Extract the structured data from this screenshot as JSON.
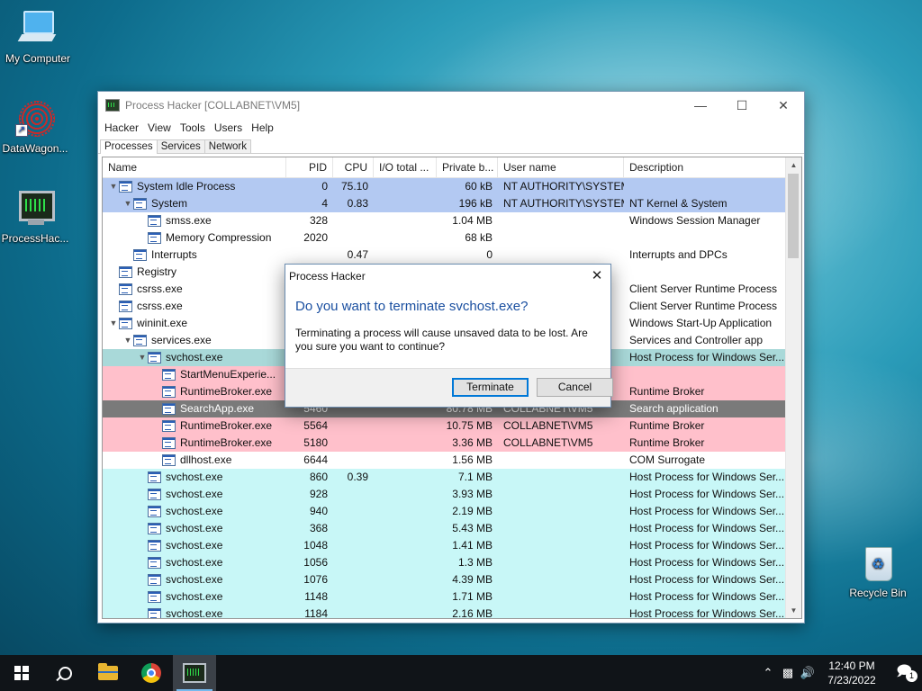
{
  "desktop": {
    "icons": [
      {
        "label": "My Computer"
      },
      {
        "label": "DataWagon..."
      },
      {
        "label": "ProcessHac..."
      },
      {
        "label": "Recycle Bin"
      }
    ]
  },
  "window": {
    "title": "Process Hacker [COLLABNET\\VM5]",
    "menu": [
      "Hacker",
      "View",
      "Tools",
      "Users",
      "Help"
    ],
    "tabs": [
      "Processes",
      "Services",
      "Network"
    ],
    "columns": [
      "Name",
      "PID",
      "CPU",
      "I/O total ...",
      "Private b...",
      "User name",
      "Description"
    ],
    "rows": [
      {
        "name": "System Idle Process",
        "level": 0,
        "expander": "▼",
        "pid": "0",
        "cpu": "75.10",
        "io": "",
        "priv": "60 kB",
        "user": "NT AUTHORITY\\SYSTEM",
        "desc": "",
        "bg": "#b3c9f2"
      },
      {
        "name": "System",
        "level": 1,
        "expander": "▼",
        "pid": "4",
        "cpu": "0.83",
        "io": "",
        "priv": "196 kB",
        "user": "NT AUTHORITY\\SYSTEM",
        "desc": "NT Kernel & System",
        "bg": "#b3c9f2"
      },
      {
        "name": "smss.exe",
        "level": 2,
        "expander": "",
        "pid": "328",
        "cpu": "",
        "io": "",
        "priv": "1.04 MB",
        "user": "",
        "desc": "Windows Session Manager",
        "bg": "#ffffff"
      },
      {
        "name": "Memory Compression",
        "level": 2,
        "expander": "",
        "pid": "2020",
        "cpu": "",
        "io": "",
        "priv": "68 kB",
        "user": "",
        "desc": "",
        "bg": "#ffffff"
      },
      {
        "name": "Interrupts",
        "level": 1,
        "expander": "",
        "pid": "",
        "cpu": "0.47",
        "io": "",
        "priv": "0",
        "user": "",
        "desc": "Interrupts and DPCs",
        "bg": "#ffffff"
      },
      {
        "name": "Registry",
        "level": 0,
        "expander": "",
        "pid": "",
        "cpu": "",
        "io": "",
        "priv": "",
        "user": "",
        "desc": "",
        "bg": "#ffffff"
      },
      {
        "name": "csrss.exe",
        "level": 0,
        "expander": "",
        "pid": "",
        "cpu": "",
        "io": "",
        "priv": "",
        "user": "",
        "desc": "Client Server Runtime Process",
        "bg": "#ffffff"
      },
      {
        "name": "csrss.exe",
        "level": 0,
        "expander": "",
        "pid": "",
        "cpu": "",
        "io": "",
        "priv": "",
        "user": "",
        "desc": "Client Server Runtime Process",
        "bg": "#ffffff"
      },
      {
        "name": "wininit.exe",
        "level": 0,
        "expander": "▼",
        "pid": "",
        "cpu": "",
        "io": "",
        "priv": "",
        "user": "",
        "desc": "Windows Start-Up Application",
        "bg": "#ffffff"
      },
      {
        "name": "services.exe",
        "level": 1,
        "expander": "▼",
        "pid": "",
        "cpu": "",
        "io": "",
        "priv": "",
        "user": "",
        "desc": "Services and Controller app",
        "bg": "#ffffff"
      },
      {
        "name": "svchost.exe",
        "level": 2,
        "expander": "▼",
        "pid": "",
        "cpu": "",
        "io": "",
        "priv": "",
        "user": "",
        "desc": "Host Process for Windows Ser...",
        "bg": "#a9d9d9"
      },
      {
        "name": "StartMenuExperie...",
        "level": 3,
        "expander": "",
        "pid": "",
        "cpu": "",
        "io": "",
        "priv": "",
        "user": "",
        "desc": "",
        "bg": "#ffc0cb"
      },
      {
        "name": "RuntimeBroker.exe",
        "level": 3,
        "expander": "",
        "pid": "",
        "cpu": "",
        "io": "",
        "priv": "",
        "user": "",
        "desc": "Runtime Broker",
        "bg": "#ffc0cb"
      },
      {
        "name": "SearchApp.exe",
        "level": 3,
        "expander": "",
        "pid": "5460",
        "cpu": "",
        "io": "",
        "priv": "80.78 MB",
        "user": "COLLABNET\\VM5",
        "desc": "Search application",
        "bg": "#7a7a7a"
      },
      {
        "name": "RuntimeBroker.exe",
        "level": 3,
        "expander": "",
        "pid": "5564",
        "cpu": "",
        "io": "",
        "priv": "10.75 MB",
        "user": "COLLABNET\\VM5",
        "desc": "Runtime Broker",
        "bg": "#ffc0cb"
      },
      {
        "name": "RuntimeBroker.exe",
        "level": 3,
        "expander": "",
        "pid": "5180",
        "cpu": "",
        "io": "",
        "priv": "3.36 MB",
        "user": "COLLABNET\\VM5",
        "desc": "Runtime Broker",
        "bg": "#ffc0cb"
      },
      {
        "name": "dllhost.exe",
        "level": 3,
        "expander": "",
        "pid": "6644",
        "cpu": "",
        "io": "",
        "priv": "1.56 MB",
        "user": "",
        "desc": "COM Surrogate",
        "bg": "#ffffff"
      },
      {
        "name": "svchost.exe",
        "level": 2,
        "expander": "",
        "pid": "860",
        "cpu": "0.39",
        "io": "",
        "priv": "7.1 MB",
        "user": "",
        "desc": "Host Process for Windows Ser...",
        "bg": "#c8f7f7"
      },
      {
        "name": "svchost.exe",
        "level": 2,
        "expander": "",
        "pid": "928",
        "cpu": "",
        "io": "",
        "priv": "3.93 MB",
        "user": "",
        "desc": "Host Process for Windows Ser...",
        "bg": "#c8f7f7"
      },
      {
        "name": "svchost.exe",
        "level": 2,
        "expander": "",
        "pid": "940",
        "cpu": "",
        "io": "",
        "priv": "2.19 MB",
        "user": "",
        "desc": "Host Process for Windows Ser...",
        "bg": "#c8f7f7"
      },
      {
        "name": "svchost.exe",
        "level": 2,
        "expander": "",
        "pid": "368",
        "cpu": "",
        "io": "",
        "priv": "5.43 MB",
        "user": "",
        "desc": "Host Process for Windows Ser...",
        "bg": "#c8f7f7"
      },
      {
        "name": "svchost.exe",
        "level": 2,
        "expander": "",
        "pid": "1048",
        "cpu": "",
        "io": "",
        "priv": "1.41 MB",
        "user": "",
        "desc": "Host Process for Windows Ser...",
        "bg": "#c8f7f7"
      },
      {
        "name": "svchost.exe",
        "level": 2,
        "expander": "",
        "pid": "1056",
        "cpu": "",
        "io": "",
        "priv": "1.3 MB",
        "user": "",
        "desc": "Host Process for Windows Ser...",
        "bg": "#c8f7f7"
      },
      {
        "name": "svchost.exe",
        "level": 2,
        "expander": "",
        "pid": "1076",
        "cpu": "",
        "io": "",
        "priv": "4.39 MB",
        "user": "",
        "desc": "Host Process for Windows Ser...",
        "bg": "#c8f7f7"
      },
      {
        "name": "svchost.exe",
        "level": 2,
        "expander": "",
        "pid": "1148",
        "cpu": "",
        "io": "",
        "priv": "1.71 MB",
        "user": "",
        "desc": "Host Process for Windows Ser...",
        "bg": "#c8f7f7"
      },
      {
        "name": "svchost.exe",
        "level": 2,
        "expander": "",
        "pid": "1184",
        "cpu": "",
        "io": "",
        "priv": "2.16 MB",
        "user": "",
        "desc": "Host Process for Windows Ser...",
        "bg": "#c8f7f7"
      }
    ]
  },
  "dialog": {
    "title": "Process Hacker",
    "main_instruction": "Do you want to terminate svchost.exe?",
    "content": "Terminating a process will cause unsaved data to be lost. Are you sure you want to continue?",
    "terminate_label": "Terminate",
    "cancel_label": "Cancel",
    "close_glyph": "✕"
  },
  "taskbar": {
    "time": "12:40 PM",
    "date": "7/23/2022",
    "notification_count": "1"
  }
}
